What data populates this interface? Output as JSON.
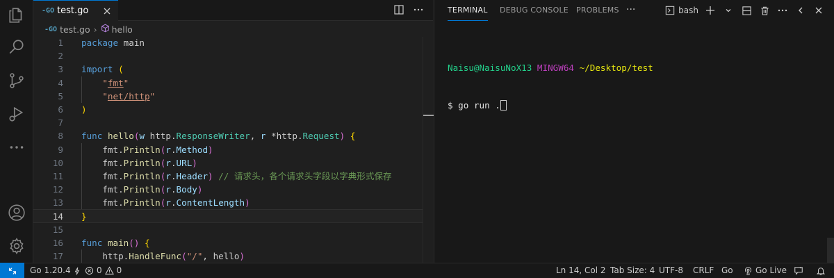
{
  "editor": {
    "tab": {
      "badge": "-GO",
      "filename": "test.go"
    },
    "breadcrumb": {
      "badge": "-GO",
      "file": "test.go",
      "symbol": "hello"
    },
    "current_line": 14,
    "lines": [
      {
        "n": "1",
        "tokens": [
          {
            "t": "package",
            "c": "k"
          },
          {
            "t": " main",
            "c": "d"
          }
        ]
      },
      {
        "n": "2",
        "tokens": []
      },
      {
        "n": "3",
        "tokens": [
          {
            "t": "import",
            "c": "k"
          },
          {
            "t": " ",
            "c": "d"
          },
          {
            "t": "(",
            "c": "p"
          }
        ]
      },
      {
        "n": "4",
        "indent": true,
        "tokens": [
          {
            "t": "    \"",
            "c": "s"
          },
          {
            "t": "fmt",
            "c": "su"
          },
          {
            "t": "\"",
            "c": "s"
          }
        ]
      },
      {
        "n": "5",
        "indent": true,
        "tokens": [
          {
            "t": "    \"",
            "c": "s"
          },
          {
            "t": "net/http",
            "c": "su"
          },
          {
            "t": "\"",
            "c": "s"
          }
        ]
      },
      {
        "n": "6",
        "tokens": [
          {
            "t": ")",
            "c": "p"
          }
        ]
      },
      {
        "n": "7",
        "tokens": []
      },
      {
        "n": "8",
        "tokens": [
          {
            "t": "func",
            "c": "k"
          },
          {
            "t": " ",
            "c": "d"
          },
          {
            "t": "hello",
            "c": "f"
          },
          {
            "t": "(",
            "c": "pp"
          },
          {
            "t": "w",
            "c": "v"
          },
          {
            "t": " http.",
            "c": "d"
          },
          {
            "t": "ResponseWriter",
            "c": "t"
          },
          {
            "t": ", ",
            "c": "d"
          },
          {
            "t": "r",
            "c": "v"
          },
          {
            "t": " *http.",
            "c": "d"
          },
          {
            "t": "Request",
            "c": "t"
          },
          {
            "t": ")",
            "c": "pp"
          },
          {
            "t": " ",
            "c": "d"
          },
          {
            "t": "{",
            "c": "p"
          }
        ]
      },
      {
        "n": "9",
        "indent": true,
        "tokens": [
          {
            "t": "    fmt.",
            "c": "d"
          },
          {
            "t": "Println",
            "c": "f"
          },
          {
            "t": "(",
            "c": "pp"
          },
          {
            "t": "r",
            "c": "v"
          },
          {
            "t": ".",
            "c": "d"
          },
          {
            "t": "Method",
            "c": "v"
          },
          {
            "t": ")",
            "c": "pp"
          }
        ]
      },
      {
        "n": "10",
        "indent": true,
        "tokens": [
          {
            "t": "    fmt.",
            "c": "d"
          },
          {
            "t": "Println",
            "c": "f"
          },
          {
            "t": "(",
            "c": "pp"
          },
          {
            "t": "r",
            "c": "v"
          },
          {
            "t": ".",
            "c": "d"
          },
          {
            "t": "URL",
            "c": "v"
          },
          {
            "t": ")",
            "c": "pp"
          }
        ]
      },
      {
        "n": "11",
        "indent": true,
        "tokens": [
          {
            "t": "    fmt.",
            "c": "d"
          },
          {
            "t": "Println",
            "c": "f"
          },
          {
            "t": "(",
            "c": "pp"
          },
          {
            "t": "r",
            "c": "v"
          },
          {
            "t": ".",
            "c": "d"
          },
          {
            "t": "Header",
            "c": "v"
          },
          {
            "t": ")",
            "c": "pp"
          },
          {
            "t": " // 请求头，各个请求头字段以字典形式保存",
            "c": "c"
          }
        ]
      },
      {
        "n": "12",
        "indent": true,
        "tokens": [
          {
            "t": "    fmt.",
            "c": "d"
          },
          {
            "t": "Println",
            "c": "f"
          },
          {
            "t": "(",
            "c": "pp"
          },
          {
            "t": "r",
            "c": "v"
          },
          {
            "t": ".",
            "c": "d"
          },
          {
            "t": "Body",
            "c": "v"
          },
          {
            "t": ")",
            "c": "pp"
          }
        ]
      },
      {
        "n": "13",
        "indent": true,
        "tokens": [
          {
            "t": "    fmt.",
            "c": "d"
          },
          {
            "t": "Println",
            "c": "f"
          },
          {
            "t": "(",
            "c": "pp"
          },
          {
            "t": "r",
            "c": "v"
          },
          {
            "t": ".",
            "c": "d"
          },
          {
            "t": "ContentLength",
            "c": "v"
          },
          {
            "t": ")",
            "c": "pp"
          }
        ]
      },
      {
        "n": "14",
        "tokens": [
          {
            "t": "}",
            "c": "p"
          }
        ]
      },
      {
        "n": "15",
        "tokens": []
      },
      {
        "n": "16",
        "tokens": [
          {
            "t": "func",
            "c": "k"
          },
          {
            "t": " ",
            "c": "d"
          },
          {
            "t": "main",
            "c": "f"
          },
          {
            "t": "()",
            "c": "pp"
          },
          {
            "t": " ",
            "c": "d"
          },
          {
            "t": "{",
            "c": "p"
          }
        ]
      },
      {
        "n": "17",
        "indent": true,
        "tokens": [
          {
            "t": "    http.",
            "c": "d"
          },
          {
            "t": "HandleFunc",
            "c": "f"
          },
          {
            "t": "(",
            "c": "pp"
          },
          {
            "t": "\"/\"",
            "c": "s"
          },
          {
            "t": ", hello",
            "c": "d"
          },
          {
            "t": ")",
            "c": "pp"
          }
        ]
      }
    ]
  },
  "panel": {
    "tabs": [
      "TERMINAL",
      "DEBUG CONSOLE",
      "PROBLEMS"
    ],
    "active_tab": "TERMINAL",
    "more": "···",
    "shell": "bash",
    "terminal": {
      "user": "Naisu@NaisuNoX13",
      "env": "MINGW64",
      "path": "~/Desktop/test",
      "prompt": "$ go run ."
    }
  },
  "statusbar": {
    "go_version": "Go 1.20.4",
    "errors": "0",
    "warnings": "0",
    "position": "Ln 14, Col 2",
    "tab_size": "Tab Size: 4",
    "encoding": "UTF-8",
    "eol": "CRLF",
    "language": "Go",
    "go_live": "Go Live"
  },
  "colors": {
    "accent": "#0078d4",
    "keyword": "#569cd6",
    "string": "#ce9178",
    "function": "#dcdcaa",
    "type": "#4ec9b0",
    "variable": "#9cdcfe",
    "comment": "#6a9955"
  }
}
